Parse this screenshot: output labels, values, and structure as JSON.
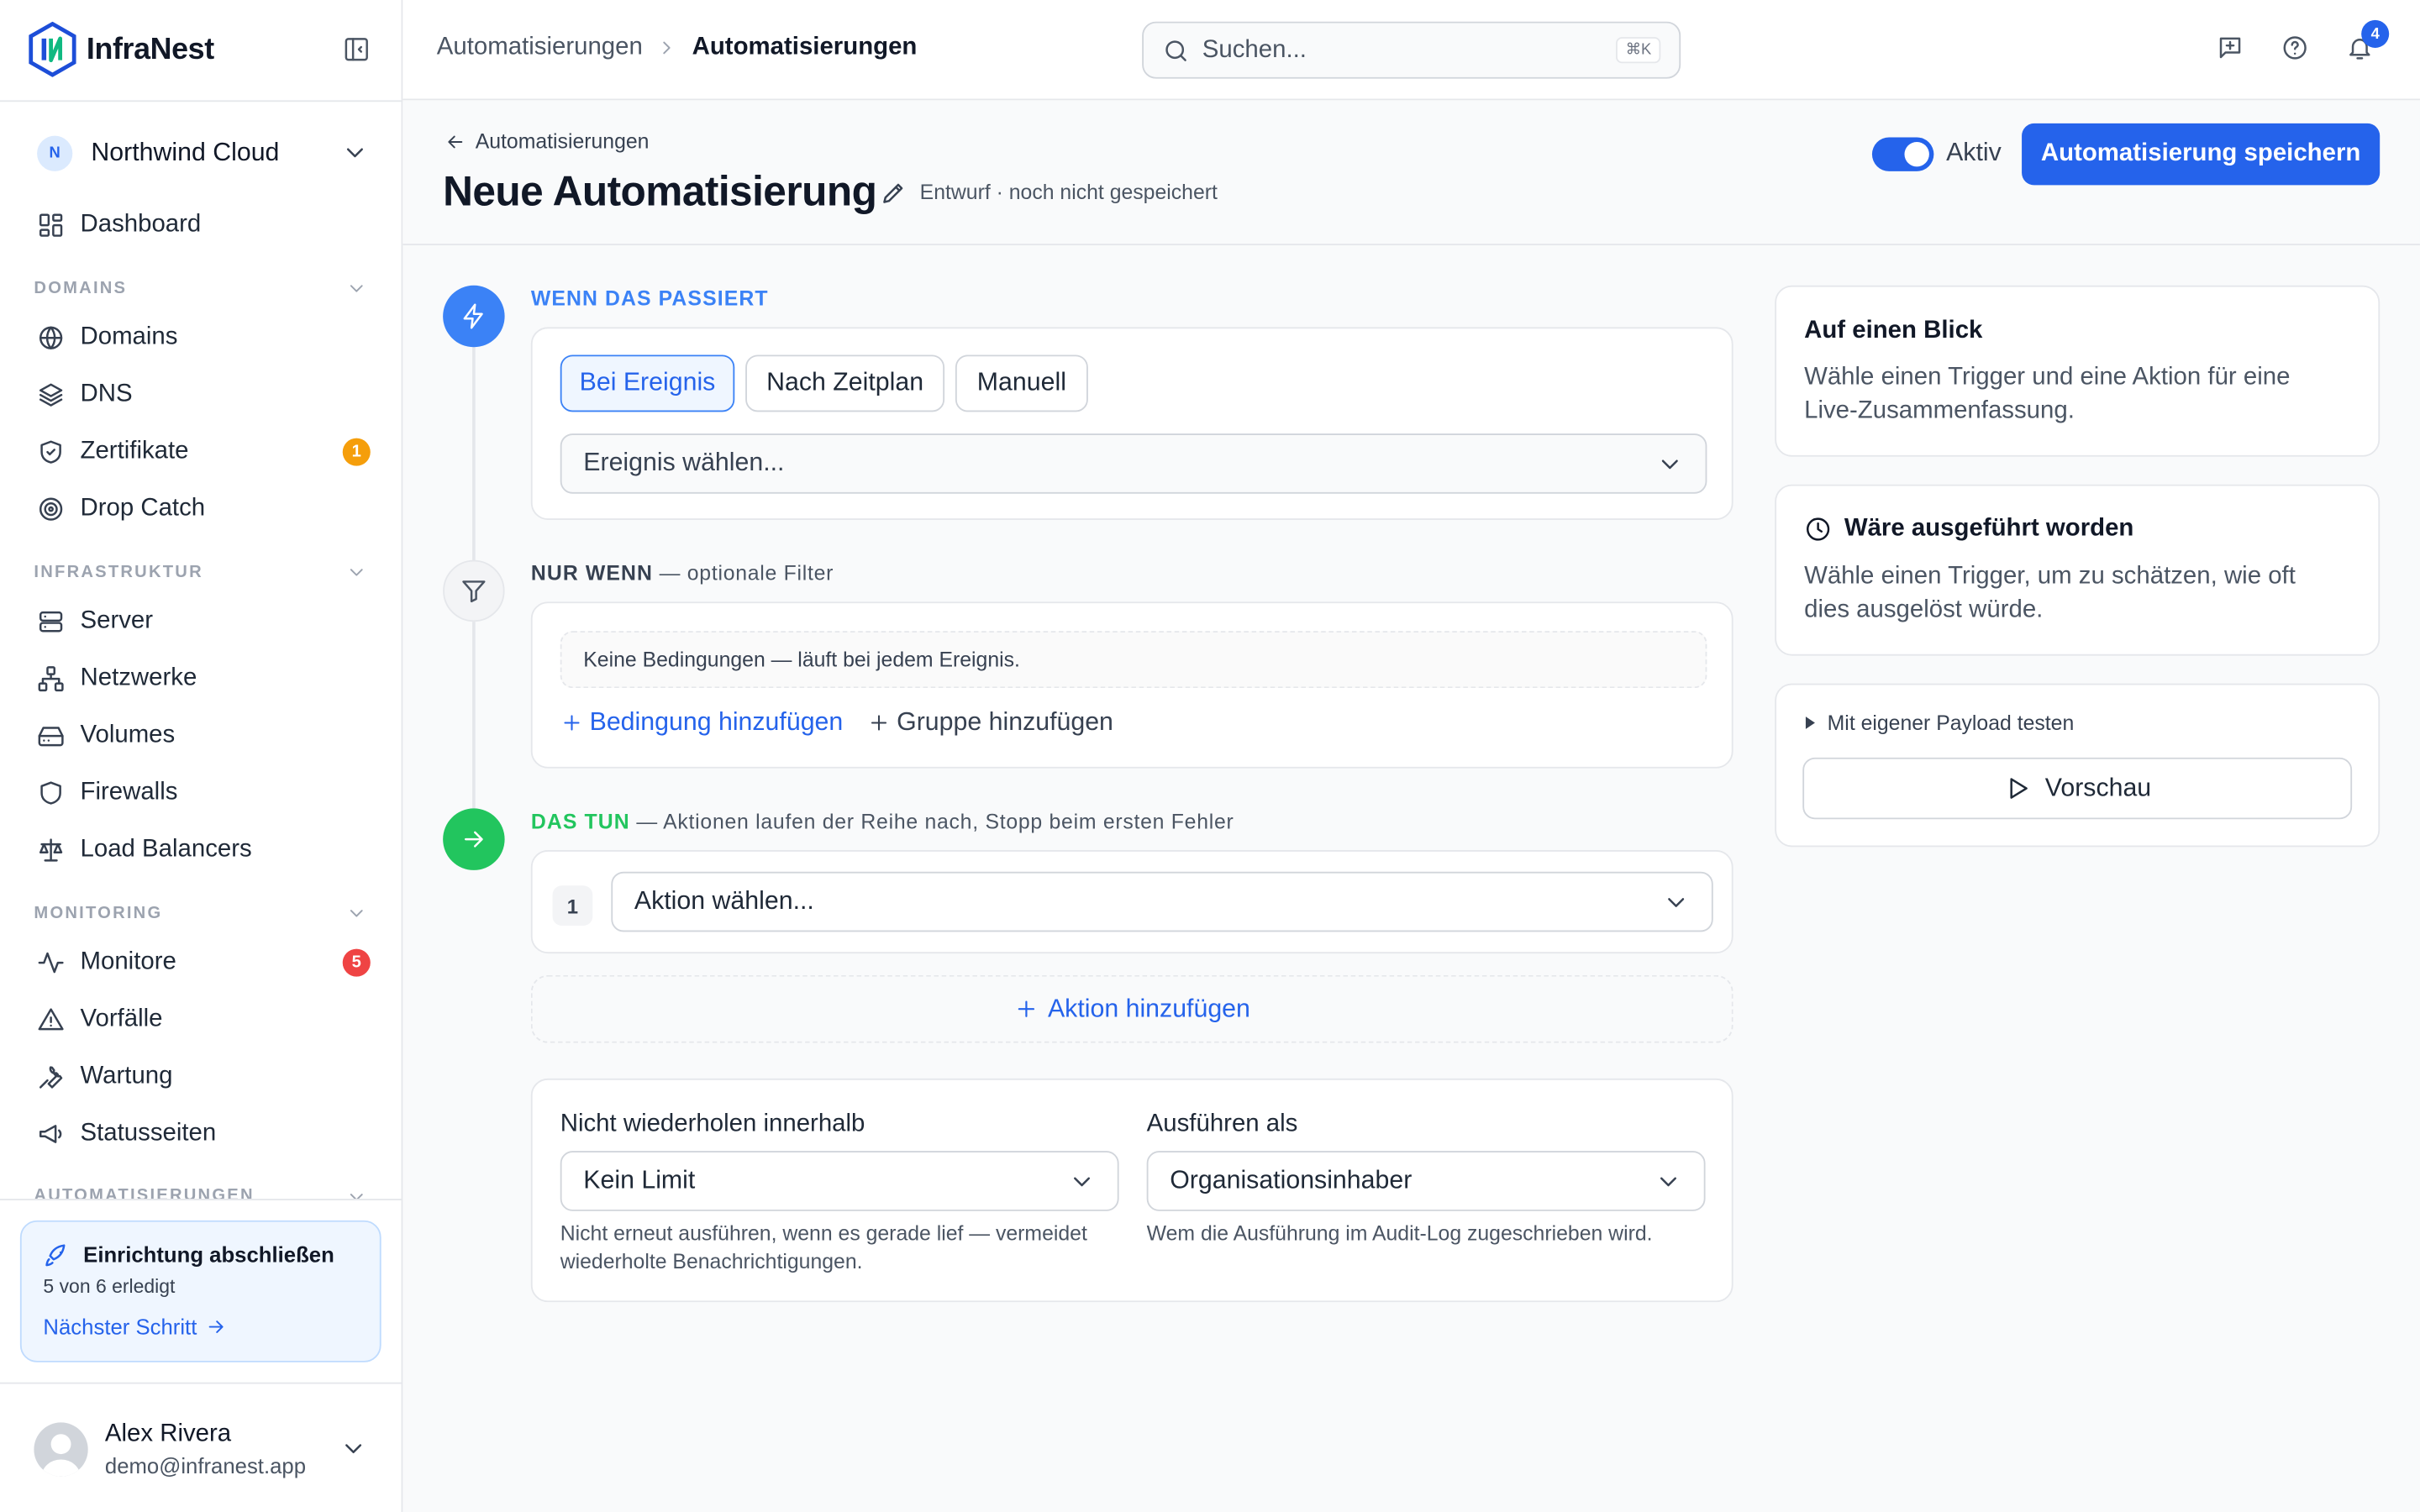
{
  "app": {
    "name": "InfraNest"
  },
  "sidebar": {
    "org": {
      "initial": "N",
      "name": "Northwind Cloud"
    },
    "dashboard": "Dashboard",
    "sections": [
      {
        "title": "DOMAINS",
        "items": [
          {
            "label": "Domains",
            "icon": "globe-icon"
          },
          {
            "label": "DNS",
            "icon": "layers-icon"
          },
          {
            "label": "Zertifikate",
            "icon": "shield-check-icon",
            "badge": "1",
            "badge_color": "#f59e0b"
          },
          {
            "label": "Drop Catch",
            "icon": "target-icon"
          }
        ]
      },
      {
        "title": "INFRASTRUKTUR",
        "items": [
          {
            "label": "Server",
            "icon": "server-icon"
          },
          {
            "label": "Netzwerke",
            "icon": "network-icon"
          },
          {
            "label": "Volumes",
            "icon": "hard-drive-icon"
          },
          {
            "label": "Firewalls",
            "icon": "shield-icon"
          },
          {
            "label": "Load Balancers",
            "icon": "scale-icon"
          }
        ]
      },
      {
        "title": "MONITORING",
        "items": [
          {
            "label": "Monitore",
            "icon": "activity-icon",
            "badge": "5",
            "badge_color": "#ef4444"
          },
          {
            "label": "Vorfälle",
            "icon": "alert-triangle-icon"
          },
          {
            "label": "Wartung",
            "icon": "wrench-icon"
          },
          {
            "label": "Statusseiten",
            "icon": "megaphone-icon"
          }
        ]
      },
      {
        "title": "AUTOMATISIERUNGEN"
      }
    ],
    "setup": {
      "title": "Einrichtung abschließen",
      "progress": "5 von 6 erledigt",
      "link": "Nächster Schritt"
    },
    "user": {
      "name": "Alex Rivera",
      "email": "demo@infranest.app"
    }
  },
  "topbar": {
    "breadcrumb": [
      "Automatisierungen",
      "Automatisierungen"
    ],
    "search_placeholder": "Suchen...",
    "search_shortcut": "⌘K",
    "notifications_count": "4"
  },
  "header": {
    "back": "Automatisierungen",
    "title": "Neue Automatisierung",
    "status": "Entwurf · noch nicht gespeichert",
    "toggle_label": "Aktiv",
    "toggle_on": true,
    "save": "Automatisierung speichern"
  },
  "trigger": {
    "label": "WENN DAS PASSIERT",
    "modes": [
      "Bei Ereignis",
      "Nach Zeitplan",
      "Manuell"
    ],
    "active_mode": "Bei Ereignis",
    "event_select": "Ereignis wählen..."
  },
  "filter": {
    "label": "NUR WENN",
    "suffix": " — optionale Filter",
    "empty": "Keine Bedingungen — läuft bei jedem Ereignis.",
    "add_condition": "Bedingung hinzufügen",
    "add_group": "Gruppe hinzufügen"
  },
  "actions": {
    "label": "DAS TUN",
    "suffix": " — Aktionen laufen der Reihe nach, Stopp beim ersten Fehler",
    "items": [
      {
        "number": "1",
        "select": "Aktion wählen..."
      }
    ],
    "add": "Aktion hinzufügen"
  },
  "settings": {
    "throttle": {
      "label": "Nicht wiederholen innerhalb",
      "value": "Kein Limit",
      "help": "Nicht erneut ausführen, wenn es gerade lief — vermeidet wiederholte Benachrichtigungen."
    },
    "run_as": {
      "label": "Ausführen als",
      "value": "Organisationsinhaber",
      "help": "Wem die Ausführung im Audit-Log zugeschrieben wird."
    }
  },
  "side": {
    "summary": {
      "title": "Auf einen Blick",
      "body": "Wähle einen Trigger und eine Aktion für eine Live-Zusammenfassung."
    },
    "estimate": {
      "title": "Wäre ausgeführt worden",
      "body": "Wähle einen Trigger, um zu schätzen, wie oft dies ausgelöst würde."
    },
    "test": {
      "label": "Mit eigener Payload testen",
      "button": "Vorschau"
    }
  },
  "colors": {
    "accent": "#2563eb",
    "trigger": "#3b82f6",
    "action": "#22c55e",
    "warning": "#f59e0b",
    "danger": "#ef4444"
  }
}
